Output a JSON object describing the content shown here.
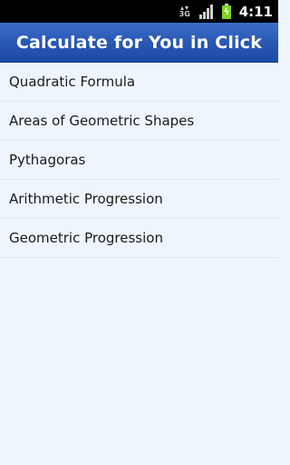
{
  "status_bar": {
    "network_type": "3G",
    "time": "4:11",
    "icons": [
      "data-activity-icon",
      "signal-strength-icon",
      "battery-charging-icon"
    ],
    "colors": {
      "background": "#000000",
      "battery": "#7ed321"
    }
  },
  "header": {
    "title": "Calculate for You in Click",
    "color": "#2756b3"
  },
  "menu": {
    "items": [
      {
        "label": "Quadratic Formula"
      },
      {
        "label": "Areas of Geometric Shapes"
      },
      {
        "label": "Pythagoras"
      },
      {
        "label": "Arithmetic Progression"
      },
      {
        "label": "Geometric Progression"
      }
    ]
  }
}
